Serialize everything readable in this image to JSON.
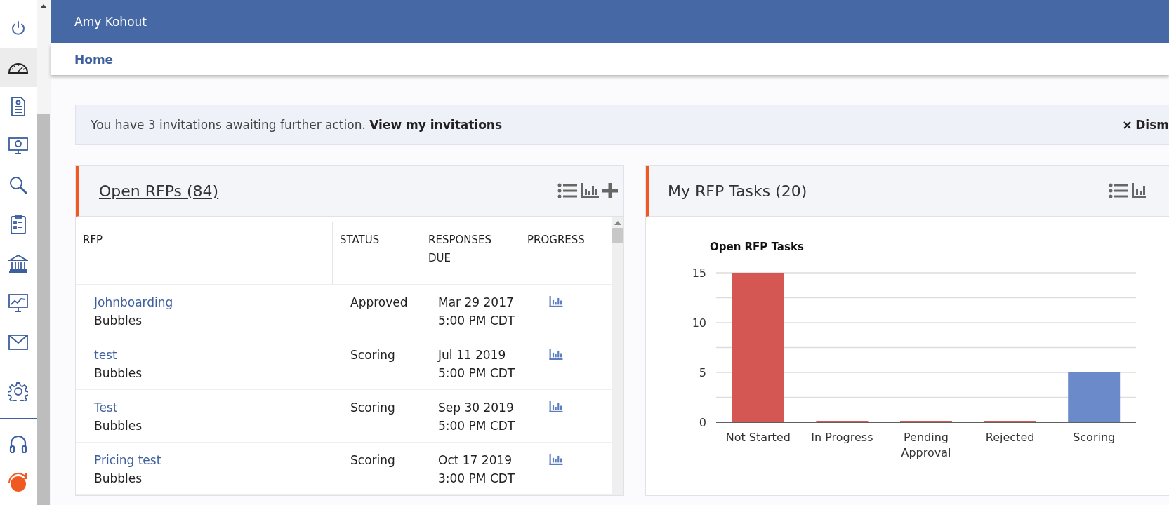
{
  "sidebar": {
    "items": [
      {
        "kind": "power",
        "selected": false
      },
      {
        "kind": "gauge",
        "selected": true
      },
      {
        "kind": "document",
        "selected": false
      },
      {
        "kind": "monitor-user",
        "selected": false
      },
      {
        "kind": "search",
        "selected": false
      },
      {
        "kind": "clipboard",
        "selected": false
      },
      {
        "kind": "bank",
        "selected": false
      },
      {
        "kind": "monitor-chart",
        "selected": false
      },
      {
        "kind": "mail",
        "selected": false
      },
      {
        "kind": "gear",
        "selected": false
      },
      {
        "kind": "headset",
        "selected": false
      },
      {
        "kind": "logo",
        "selected": false
      }
    ]
  },
  "header": {
    "user": "Amy Kohout"
  },
  "breadcrumb": "Home",
  "alert": {
    "text": "You have 3 invitations awaiting further action.",
    "link": "View my invitations",
    "dismiss": "Dism"
  },
  "open_rfps": {
    "title": "Open RFPs (84)",
    "columns": [
      "RFP",
      "STATUS",
      "RESPONSES DUE",
      "PROGRESS"
    ],
    "rows": [
      {
        "name": "Johnboarding",
        "org": "Bubbles",
        "status": "Approved",
        "due_date": "Mar 29 2017",
        "due_time": "5:00 PM CDT"
      },
      {
        "name": "test",
        "org": "Bubbles",
        "status": "Scoring",
        "due_date": "Jul 11 2019",
        "due_time": "5:00 PM CDT"
      },
      {
        "name": "Test",
        "org": "Bubbles",
        "status": "Scoring",
        "due_date": "Sep 30 2019",
        "due_time": "5:00 PM CDT"
      },
      {
        "name": "Pricing test",
        "org": "Bubbles",
        "status": "Scoring",
        "due_date": "Oct 17 2019",
        "due_time": "3:00 PM CDT"
      }
    ]
  },
  "tasks": {
    "title": "My RFP Tasks (20)",
    "chart_data": {
      "type": "bar",
      "title": "Open RFP Tasks",
      "categories": [
        "Not Started",
        "In Progress",
        "Pending Approval",
        "Rejected",
        "Scoring"
      ],
      "values": [
        15,
        0,
        0,
        0,
        5
      ],
      "colors": [
        "#d55753",
        "#d55753",
        "#d55753",
        "#d55753",
        "#6b8ac9"
      ],
      "ylim": [
        0,
        15
      ],
      "yticks": [
        0,
        5,
        10,
        15
      ]
    }
  }
}
